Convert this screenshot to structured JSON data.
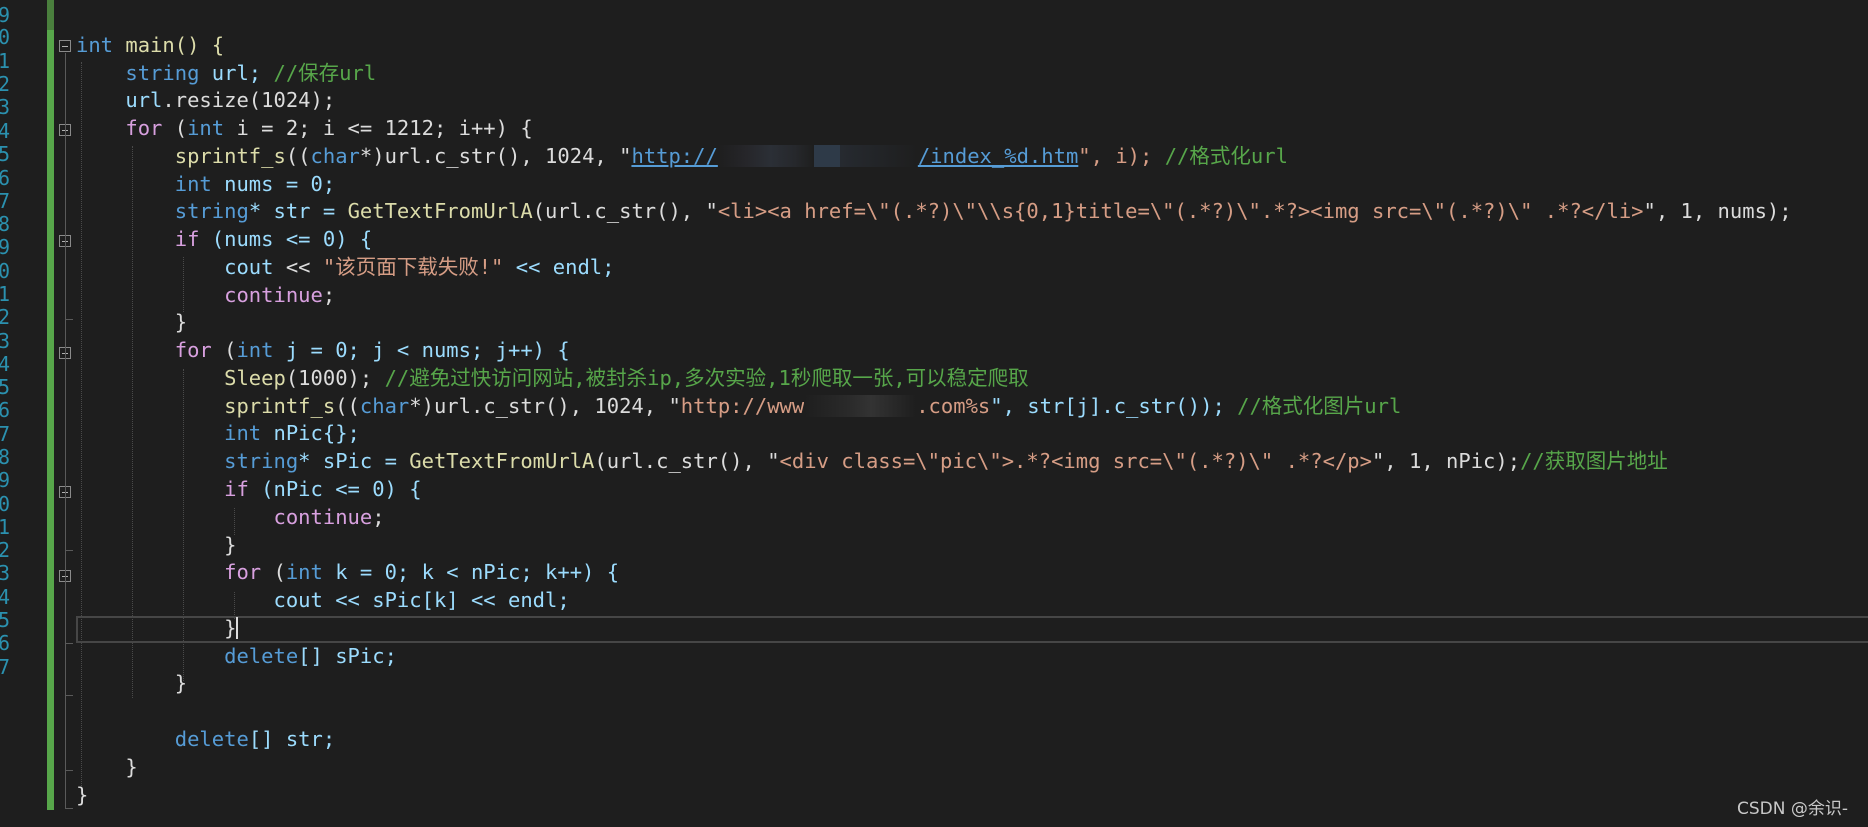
{
  "editor": {
    "line_numbers": [
      "9",
      "0",
      "1",
      "2",
      "3",
      "4",
      "5",
      "6",
      "7",
      "8",
      "9",
      "0",
      "1",
      "2",
      "3",
      "4",
      "5",
      "6",
      "7",
      "8",
      "9",
      "0",
      "1",
      "2",
      "3",
      "4",
      "5",
      "6",
      "7"
    ],
    "code": {
      "l00_a": "int",
      "l00_b": " main() {",
      "l01_a": "string",
      "l01_b": " url; ",
      "l01_c": "//保存url",
      "l02_a": "url",
      "l02_b": ".resize(1024);",
      "l03_a": "for",
      "l03_b": " (",
      "l03_c": "int",
      "l03_d": " i = 2; i <= 1212; i++) {",
      "l04_a": "sprintf_s",
      "l04_b": "((",
      "l04_c": "char",
      "l04_d": "*)url.c_str(), 1024, \"",
      "l04_e": "http://",
      "l04_f": "/index_%d.htm",
      "l04_g": "\", i); ",
      "l04_h": "//格式化url",
      "l05_a": "int",
      "l05_b": " nums = 0;",
      "l06_a": "string",
      "l06_b": "* str = ",
      "l06_c": "GetTextFromUrlA",
      "l06_d": "(url.c_str(), \"",
      "l06_e": "<li><a href=\\\"(.*?)\\\"\\\\s{0,1}title=\\\"(.*?)\\\".*?><img src=\\\"(.*?)\\\" .*?</li>",
      "l06_f": "\", 1, nums);",
      "l07_a": "if",
      "l07_b": " (nums <= 0) {",
      "l08_a": "cout",
      "l08_b": " << ",
      "l08_c": "\"该页面下载失败!\"",
      "l08_d": " << endl;",
      "l09_a": "continue",
      "l09_b": ";",
      "l10_a": "}",
      "l11_a": "for",
      "l11_b": " (",
      "l11_c": "int",
      "l11_d": " j = 0; j < nums; j++) {",
      "l12_a": "Sleep",
      "l12_b": "(1000); ",
      "l12_c": "//避免过快访问网站,被封杀ip,多次实验,1秒爬取一张,可以稳定爬取",
      "l13_a": "sprintf_s",
      "l13_b": "((",
      "l13_c": "char",
      "l13_d": "*)url.c_str(), 1024, \"",
      "l13_e": "http://www",
      "l13_f": ".com%s",
      "l13_g": "\", str[j].c_str()); ",
      "l13_h": "//格式化图片url",
      "l14_a": "int",
      "l14_b": " nPic{};",
      "l15_a": "string",
      "l15_b": "* sPic = ",
      "l15_c": "GetTextFromUrlA",
      "l15_d": "(url.c_str(), \"",
      "l15_e": "<div class=\\\"pic\\\">.*?<img src=\\\"(.*?)\\\" .*?</p>",
      "l15_f": "\", 1, nPic);",
      "l15_g": "//获取图片地址",
      "l16_a": "if",
      "l16_b": " (nPic <= 0) {",
      "l17_a": "continue",
      "l17_b": ";",
      "l18_a": "}",
      "l19_a": "for",
      "l19_b": " (",
      "l19_c": "int",
      "l19_d": " k = 0; k < nPic; k++) {",
      "l20_a": "cout",
      "l20_b": " << sPic[k] << endl;",
      "l21_a": "}",
      "l22_a": "delete",
      "l22_b": "[] sPic;",
      "l23_a": "}",
      "l25_a": "delete",
      "l25_b": "[] str;",
      "l26_a": "}",
      "l27_a": "}"
    }
  },
  "watermark": "CSDN @余识-",
  "colors": {
    "background": "#1e1e1e",
    "keyword": "#569cd6",
    "control": "#d8a0df",
    "function": "#dcdcaa",
    "variable": "#9cdcfe",
    "string": "#d69d85",
    "comment": "#57a64a",
    "line_number": "#2b91af",
    "change_bar": "#57a64a"
  }
}
